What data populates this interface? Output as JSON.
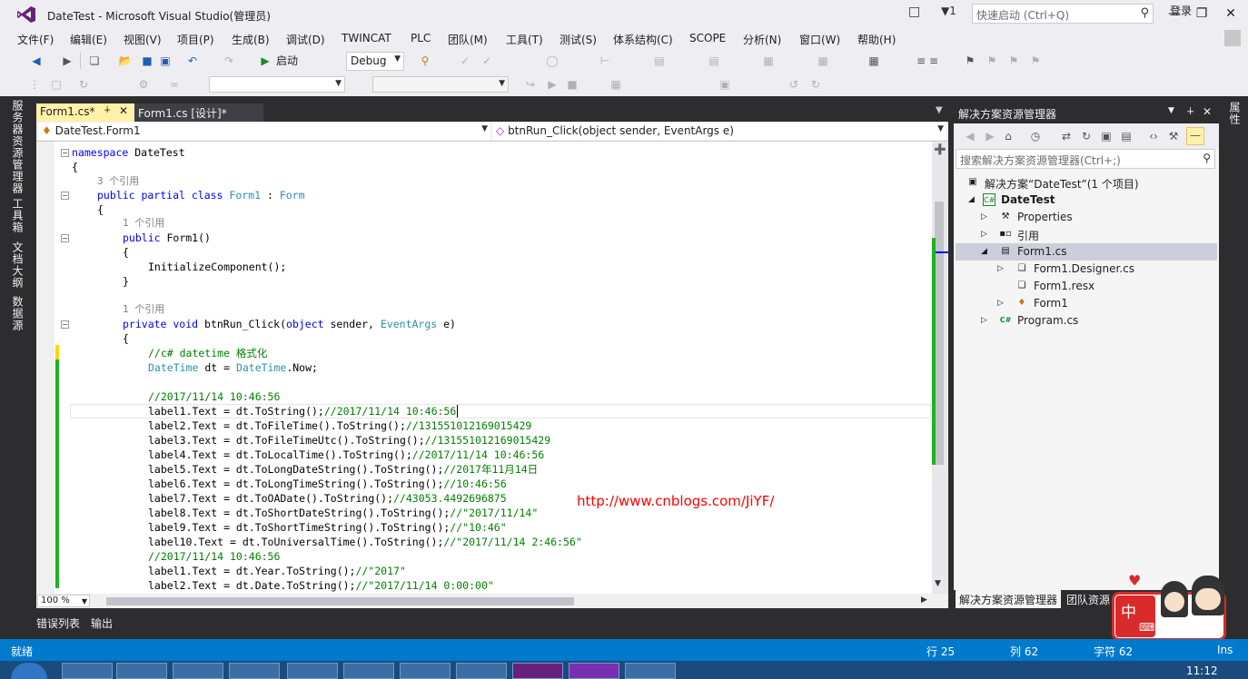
{
  "window": {
    "title": "DateTest - Microsoft Visual Studio(管理员)",
    "notif_count": "1"
  },
  "quick_launch": {
    "placeholder": "快速启动 (Ctrl+Q)"
  },
  "menu": [
    "文件(F)",
    "编辑(E)",
    "视图(V)",
    "项目(P)",
    "生成(B)",
    "调试(D)",
    "TWINCAT",
    "PLC",
    "团队(M)",
    "工具(T)",
    "测试(S)",
    "体系结构(C)",
    "SCOPE",
    "分析(N)",
    "窗口(W)",
    "帮助(H)"
  ],
  "login": "登录",
  "toolbar": {
    "start": "启动",
    "config": "Debug"
  },
  "left_tabs": [
    "服务器资源管理器",
    "工具箱",
    "文档大纲",
    "数据源"
  ],
  "tabs": [
    {
      "label": "Form1.cs*"
    },
    {
      "label": "Form1.cs [设计]*"
    }
  ],
  "nav": {
    "class": "DateTest.Form1",
    "member": "btnRun_Click(object sender, EventArgs e)"
  },
  "code": {
    "l1": "namespace",
    "l1b": " DateTest",
    "l2": "{",
    "ref3": "3 个引用",
    "l3a": "public partial class",
    "l3b": "Form1",
    "l3c": " : ",
    "l3d": "Form",
    "l4": "{",
    "ref1a": "1 个引用",
    "l5a": "public",
    "l5b": " Form1()",
    "l6": "{",
    "l7": "InitializeComponent();",
    "l8": "}",
    "ref1b": "1 个引用",
    "l9a": "private void",
    "l9b": " btnRun_Click(",
    "l9c": "object",
    "l9d": " sender, ",
    "l9e": "EventArgs",
    "l9f": " e)",
    "l10": "{",
    "c1": "//c# datetime 格式化",
    "l11a": "DateTime",
    "l11b": " dt = ",
    "l11c": "DateTime",
    "l11d": ".Now;",
    "c2": "//2017/11/14 10:46:56",
    "r1a": "label1.Text = dt.ToString();",
    "r1b": "//2017/11/14 10:46:56",
    "r2a": "label2.Text = dt.ToFileTime().ToString();",
    "r2b": "//131551012169015429",
    "r3a": "label3.Text = dt.ToFileTimeUtc().ToString();",
    "r3b": "//131551012169015429",
    "r4a": "label4.Text = dt.ToLocalTime().ToString();",
    "r4b": "//2017/11/14 10:46:56",
    "r5a": "label5.Text = dt.ToLongDateString().ToString();",
    "r5b": "//2017年11月14日",
    "r6a": "label6.Text = dt.ToLongTimeString().ToString();",
    "r6b": "//10:46:56",
    "r7a": "label7.Text = dt.ToOADate().ToString();",
    "r7b": "//43053.4492696875",
    "r8a": "label8.Text = dt.ToShortDateString().ToString();",
    "r8b": "//\"2017/11/14\"",
    "r9a": "label9.Text = dt.ToShortTimeString().ToString();",
    "r9b": "//\"10:46\"",
    "r10a": "label10.Text = dt.ToUniversalTime().ToString();",
    "r10b": "//\"2017/11/14 2:46:56\"",
    "c3": "//2017/11/14 10:46:56",
    "r11a": "label1.Text = dt.Year.ToString();",
    "r11b": "//\"2017\"",
    "r12a": "label2.Text = dt.Date.ToString();",
    "r12b": "//\"2017/11/14 0:00:00\""
  },
  "watermark": "http://www.cnblogs.com/JiYF/",
  "zoom": "100 %",
  "bottom_tabs": [
    "错误列表",
    "输出"
  ],
  "solution": {
    "title": "解决方案资源管理器",
    "search": "搜索解决方案资源管理器(Ctrl+;)",
    "root": "解决方案“DateTest”(1 个项目)",
    "project": "DateTest",
    "items": [
      "Properties",
      "引用",
      "Form1.cs",
      "Form1.Designer.cs",
      "Form1.resx",
      "Form1",
      "Program.cs"
    ],
    "bottom_tabs": [
      "解决方案资源管理器",
      "团队资源"
    ]
  },
  "properties_tab": "属性",
  "status": {
    "ready": "就绪",
    "row": "行 25",
    "col": "列 62",
    "char": "字符 62",
    "ins": "Ins"
  },
  "clock": "11:12",
  "ime": {
    "zh": "中"
  },
  "colors": {
    "accent": "#007acc",
    "tab_active": "#fff1a8",
    "keyword": "#0000ff",
    "type": "#2b91af",
    "comment": "#008000"
  }
}
